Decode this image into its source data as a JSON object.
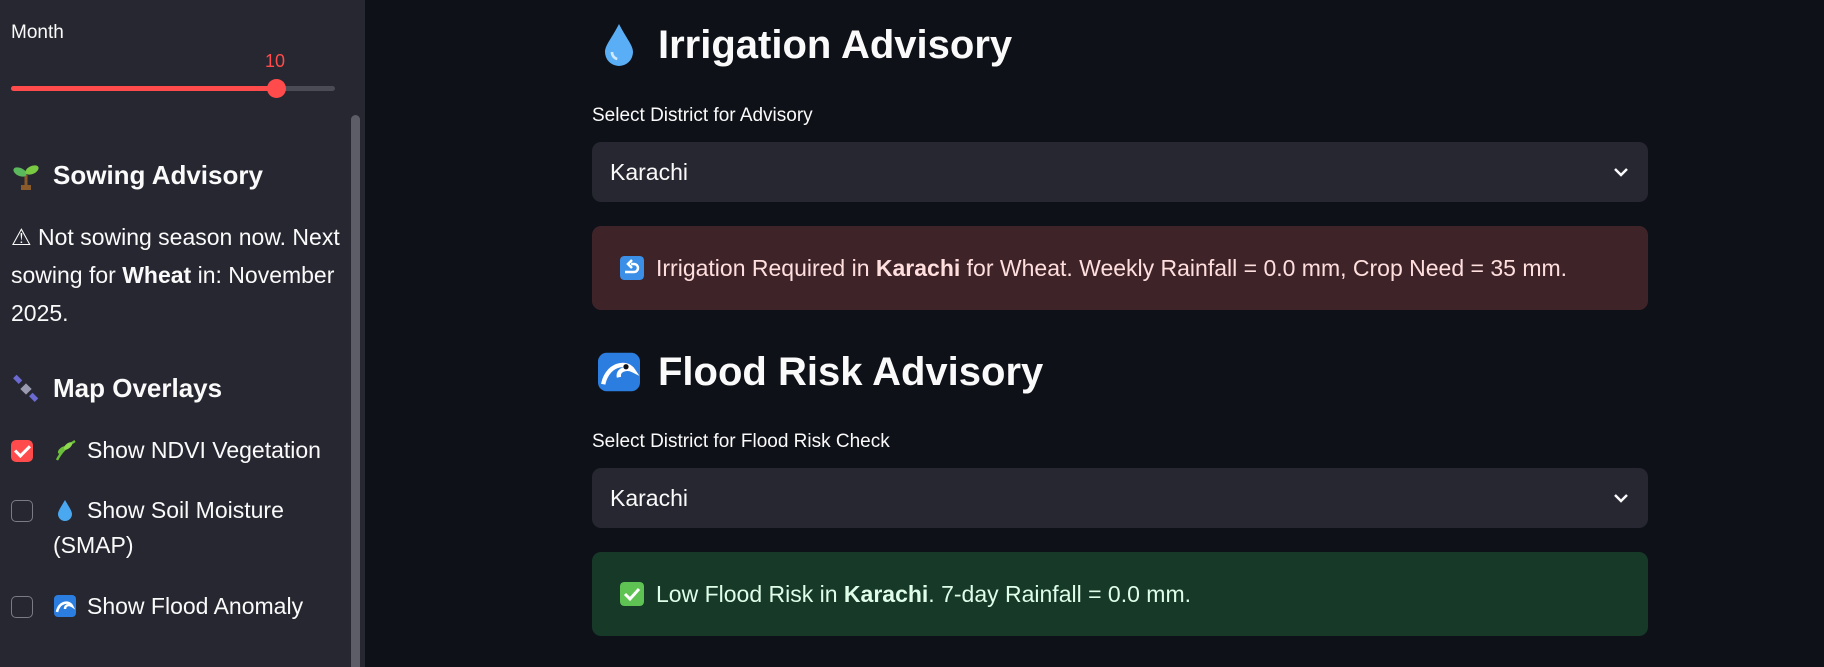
{
  "sidebar": {
    "month": {
      "label": "Month",
      "value": "10",
      "level_fraction": 0.818
    },
    "sowing": {
      "heading": "Sowing Advisory",
      "message_prefix": "⚠ Not sowing season now. Next sowing for ",
      "crop": "Wheat",
      "message_suffix": " in: November 2025."
    },
    "overlays": {
      "heading": "Map Overlays",
      "items": [
        {
          "label": "Show NDVI Vegetation",
          "checked": true,
          "icon": "herb-icon"
        },
        {
          "label": "Show Soil Moisture (SMAP)",
          "checked": false,
          "icon": "droplet-icon"
        },
        {
          "label": "Show Flood Anomaly",
          "checked": false,
          "icon": "wave-icon"
        }
      ]
    }
  },
  "irrigation": {
    "heading": "Irrigation Advisory",
    "select_label": "Select District for Advisory",
    "selected": "Karachi",
    "alert_prefix": "Irrigation Required in ",
    "alert_district": "Karachi",
    "alert_suffix": " for Wheat. Weekly Rainfall = 0.0 mm, Crop Need = 35 mm."
  },
  "flood": {
    "heading": "Flood Risk Advisory",
    "select_label": "Select District for Flood Risk Check",
    "selected": "Karachi",
    "alert_prefix": "Low Flood Risk in ",
    "alert_district": "Karachi",
    "alert_suffix": ". 7-day Rainfall = 0.0 mm."
  },
  "colors": {
    "accent": "#ff4b4b",
    "error_bg": "#3e2428",
    "success_bg": "#173928",
    "background": "#0e1117",
    "sidebar_bg": "#262730"
  }
}
